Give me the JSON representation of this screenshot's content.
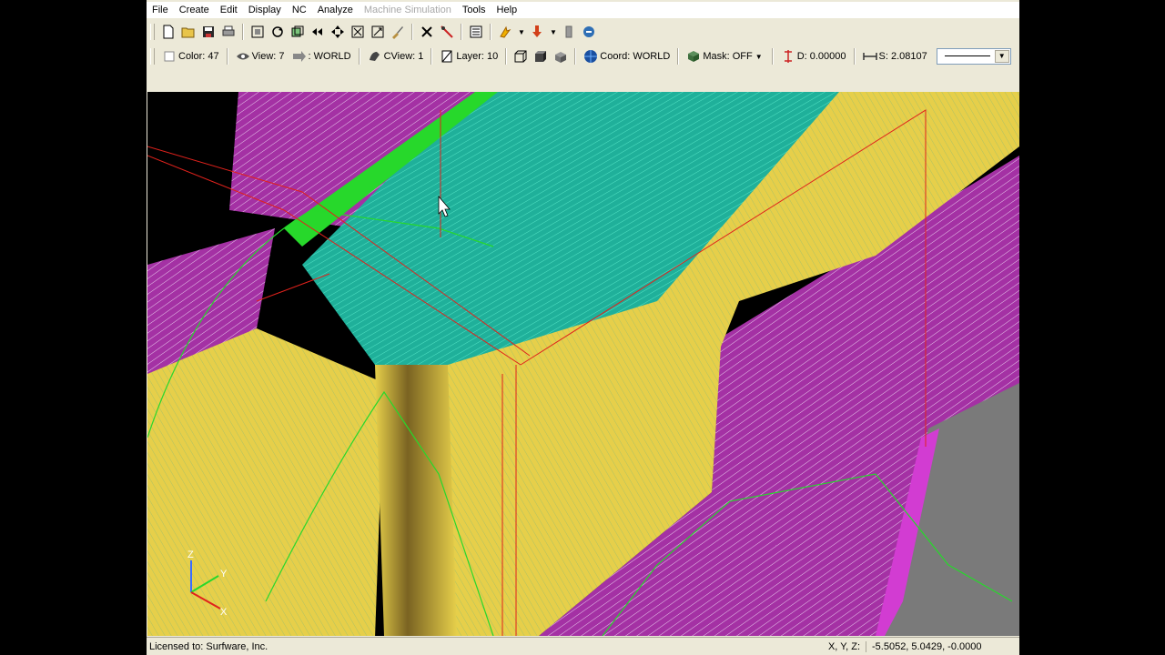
{
  "menu": [
    "File",
    "Create",
    "Edit",
    "Display",
    "NC",
    "Analyze",
    "Machine Simulation",
    "Tools",
    "Help"
  ],
  "menu_disabled": "Machine Simulation",
  "toolbar1": {
    "icons": [
      "new-file-icon",
      "open-folder-icon",
      "save-icon",
      "print-icon",
      "fit-view-icon",
      "rotate-view-icon",
      "copy-view-icon",
      "prev-view-icon",
      "pan-icon",
      "zoom-icon",
      "repaint-icon",
      "delete-icon",
      "measure-icon",
      "properties-icon",
      "shade-icon",
      "arrow-down-icon",
      "tool-library-icon",
      "help-icon"
    ]
  },
  "toolbar2": {
    "color_label": "Color: 47",
    "view_label": "View: 7",
    "world_label": ": WORLD",
    "cview_label": "CView: 1",
    "layer_label": "Layer: 10",
    "coord_label": "Coord: WORLD",
    "mask_label": "Mask: OFF",
    "depth_label": "D: 0.00000",
    "spacing_label": "S: 2.08107"
  },
  "colors": {
    "background": "#000000",
    "yellow_face": "#e6cf4a",
    "magenta_face": "#a431a4",
    "teal_face": "#1fb09a",
    "green_toolpath": "#27d82b",
    "red_lines": "#e0221c",
    "gray_face": "#7a7a7a"
  },
  "viewport": {
    "axes": [
      "Z",
      "Y",
      "X"
    ]
  },
  "status": {
    "license": "Licensed to: Surfware, Inc.",
    "coord_label": "X, Y, Z:",
    "coord_value": "-5.5052, 5.0429, -0.0000"
  }
}
